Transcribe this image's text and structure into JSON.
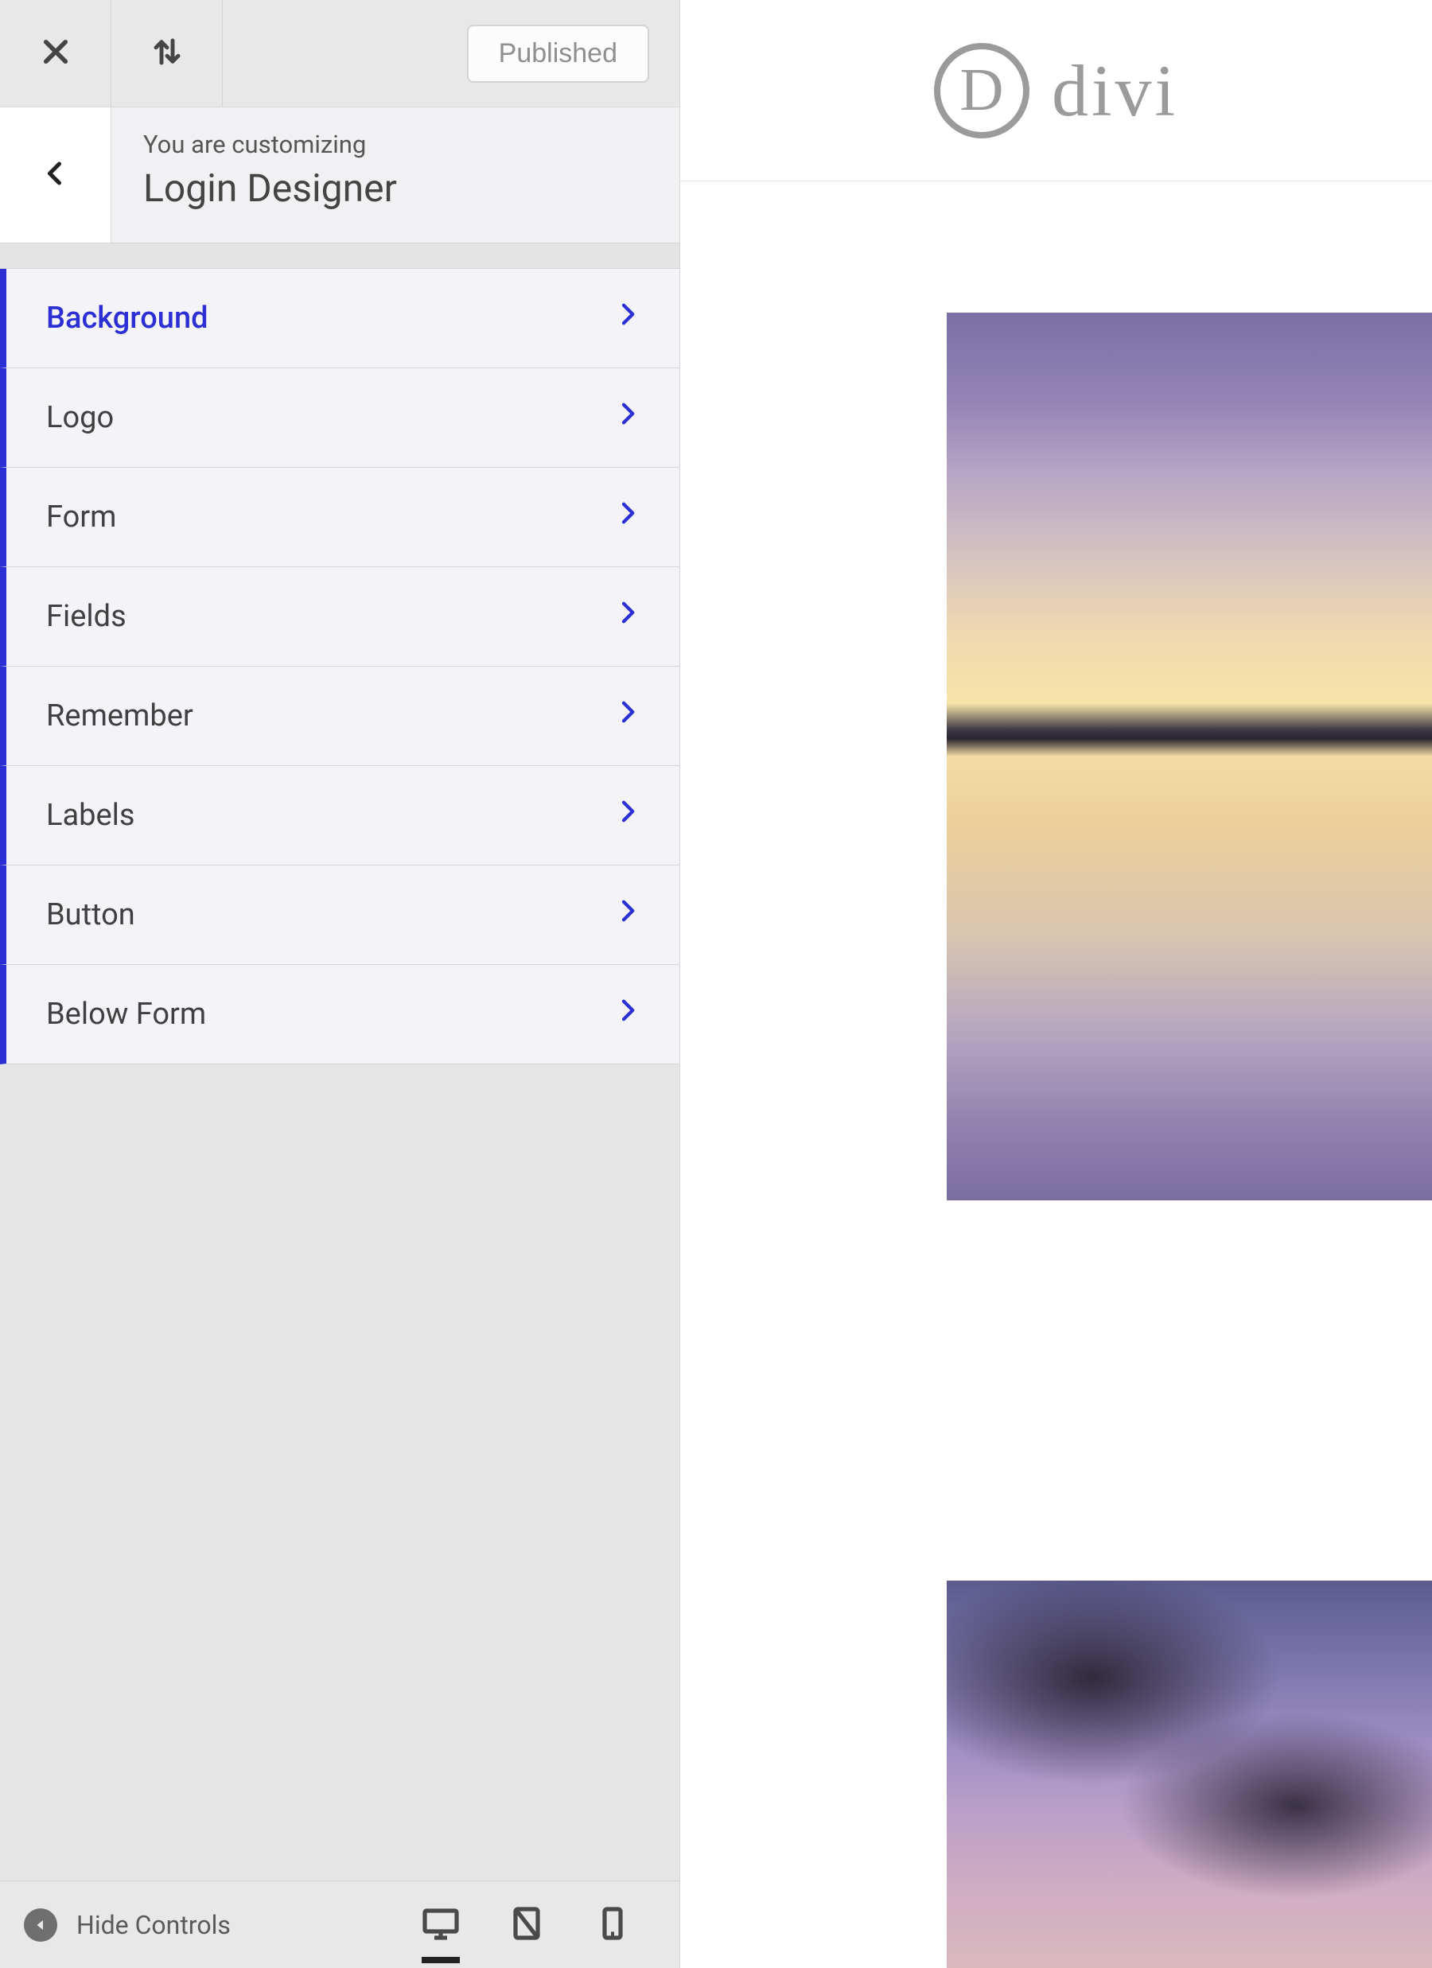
{
  "toolbar": {
    "publish_label": "Published"
  },
  "header": {
    "customizing_label": "You are customizing",
    "panel_title": "Login Designer"
  },
  "menu": {
    "items": [
      {
        "label": "Background",
        "active": true
      },
      {
        "label": "Logo",
        "active": false
      },
      {
        "label": "Form",
        "active": false
      },
      {
        "label": "Fields",
        "active": false
      },
      {
        "label": "Remember",
        "active": false
      },
      {
        "label": "Labels",
        "active": false
      },
      {
        "label": "Button",
        "active": false
      },
      {
        "label": "Below Form",
        "active": false
      }
    ]
  },
  "footer": {
    "hide_label": "Hide Controls"
  },
  "preview": {
    "brand_letter": "D",
    "brand_text": "divi"
  }
}
